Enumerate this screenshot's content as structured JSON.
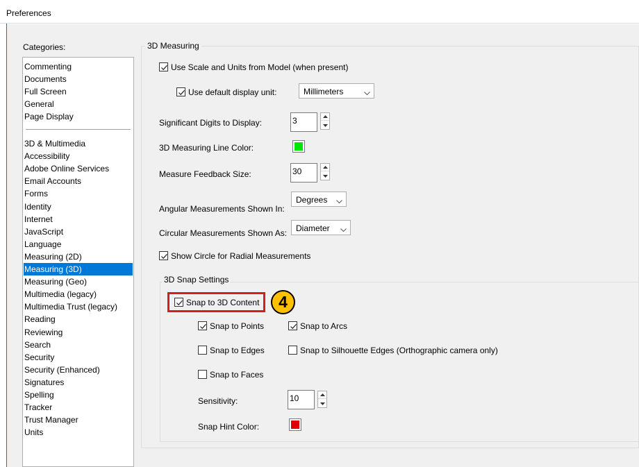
{
  "window": {
    "title": "Preferences"
  },
  "categories": {
    "label": "Categories:",
    "group1": [
      "Commenting",
      "Documents",
      "Full Screen",
      "General",
      "Page Display"
    ],
    "group2": [
      "3D & Multimedia",
      "Accessibility",
      "Adobe Online Services",
      "Email Accounts",
      "Forms",
      "Identity",
      "Internet",
      "JavaScript",
      "Language",
      "Measuring (2D)",
      "Measuring (3D)",
      "Measuring (Geo)",
      "Multimedia (legacy)",
      "Multimedia Trust (legacy)",
      "Reading",
      "Reviewing",
      "Search",
      "Security",
      "Security (Enhanced)",
      "Signatures",
      "Spelling",
      "Tracker",
      "Trust Manager",
      "Units"
    ],
    "selected": "Measuring (3D)"
  },
  "measuring": {
    "group_title": "3D Measuring",
    "use_scale": {
      "label": "Use Scale and Units from Model (when present)",
      "checked": true
    },
    "use_default_unit": {
      "label": "Use default display unit:",
      "checked": true,
      "value": "Millimeters"
    },
    "significant_digits": {
      "label": "Significant Digits to Display:",
      "value": "3"
    },
    "line_color": {
      "label": "3D Measuring Line Color:",
      "color": "#00e600"
    },
    "feedback_size": {
      "label": "Measure Feedback Size:",
      "value": "30"
    },
    "angular": {
      "label": "Angular Measurements Shown In:",
      "value": "Degrees"
    },
    "circular": {
      "label": "Circular Measurements Shown As:",
      "value": "Diameter"
    },
    "show_circle": {
      "label": "Show Circle for Radial Measurements",
      "checked": true
    }
  },
  "snap": {
    "group_title": "3D Snap Settings",
    "snap_to_content": {
      "label": "Snap to 3D Content",
      "checked": true
    },
    "snap_points": {
      "label": "Snap to Points",
      "checked": true
    },
    "snap_arcs": {
      "label": "Snap to Arcs",
      "checked": true
    },
    "snap_edges": {
      "label": "Snap to Edges",
      "checked": false
    },
    "snap_silhouette": {
      "label": "Snap to Silhouette Edges (Orthographic camera only)",
      "checked": false
    },
    "snap_faces": {
      "label": "Snap to Faces",
      "checked": false
    },
    "sensitivity": {
      "label": "Sensitivity:",
      "value": "10"
    },
    "hint_color": {
      "label": "Snap Hint Color:",
      "color": "#e00000"
    }
  },
  "annotation": {
    "step": "4",
    "highlight_color": "#d01f1f",
    "badge_color": "#ffc000"
  },
  "colors": {
    "selection": "#0078d7",
    "dialog_bg": "#f0f0f0"
  }
}
